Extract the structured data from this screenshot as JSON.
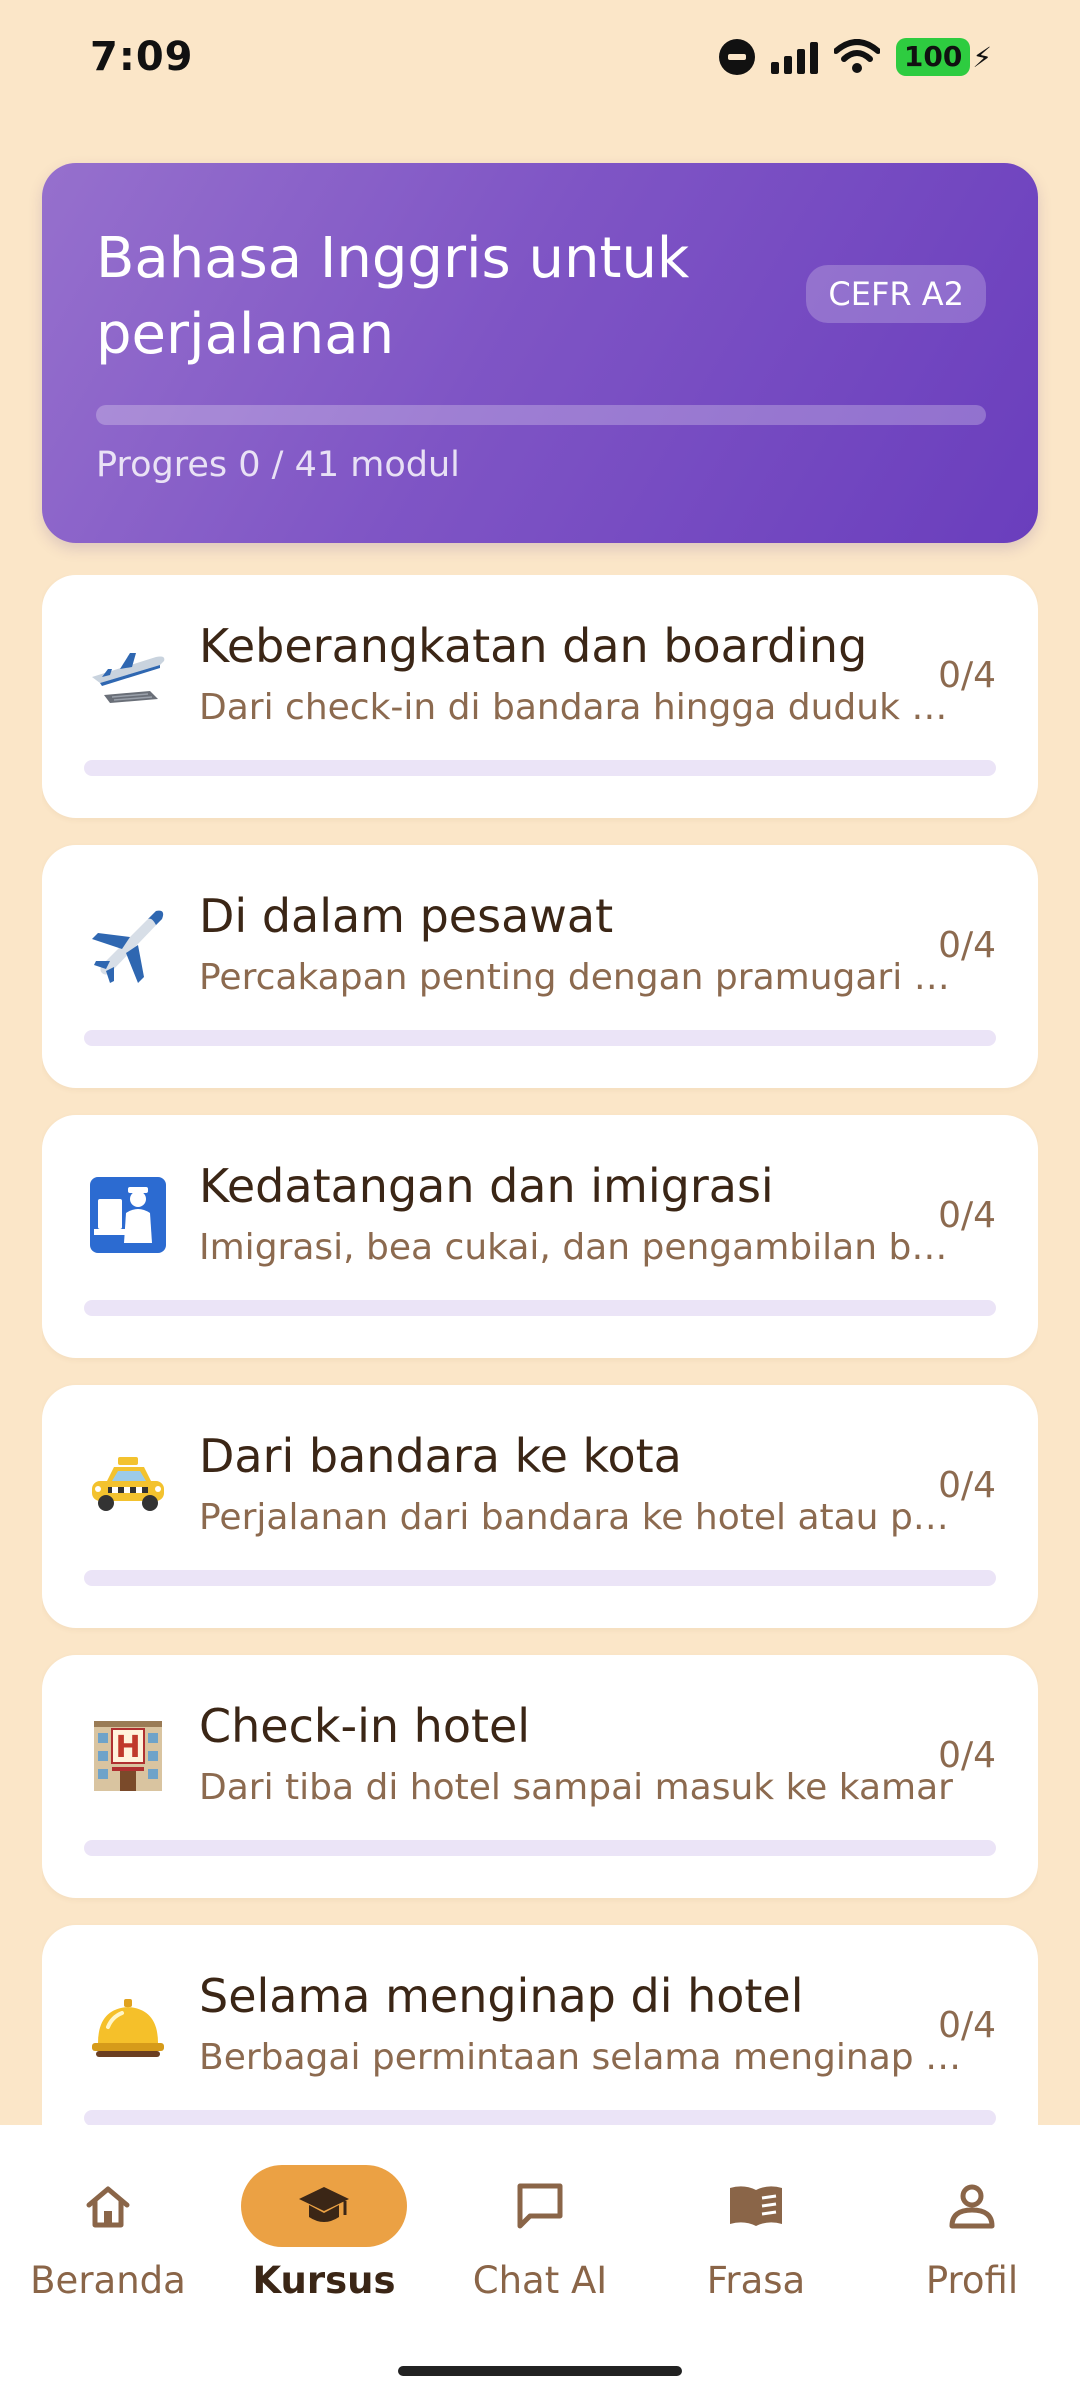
{
  "status_bar": {
    "time": "7:09",
    "battery": "100"
  },
  "course": {
    "title": "Bahasa Inggris untuk perjalanan",
    "level_badge": "CEFR A2",
    "progress_text": "Progres 0 / 41 modul",
    "progress_fraction": 0
  },
  "modules": [
    {
      "icon": "departure-plane-icon",
      "title": "Keberangkatan dan boarding",
      "description": "Dari check-in di bandara hingga duduk di kursi pesawat",
      "count": "0/4",
      "progress": 0
    },
    {
      "icon": "airplane-icon",
      "title": "Di dalam pesawat",
      "description": "Percakapan penting dengan pramugari atau penumpang lain",
      "count": "0/4",
      "progress": 0
    },
    {
      "icon": "passport-control-icon",
      "title": "Kedatangan dan imigrasi",
      "description": "Imigrasi, bea cukai, dan pengambilan bagasi",
      "count": "0/4",
      "progress": 0
    },
    {
      "icon": "taxi-icon",
      "title": "Dari bandara ke kota",
      "description": "Perjalanan dari bandara ke hotel atau pusat kota",
      "count": "0/4",
      "progress": 0
    },
    {
      "icon": "hotel-icon",
      "title": "Check-in hotel",
      "description": "Dari tiba di hotel sampai masuk ke kamar",
      "count": "0/4",
      "progress": 0
    },
    {
      "icon": "bellhop-bell-icon",
      "title": "Selama menginap di hotel",
      "description": "Berbagai permintaan selama menginap dan layanan hotel",
      "count": "0/4",
      "progress": 0
    }
  ],
  "nav": [
    {
      "label": "Beranda",
      "icon": "home-icon",
      "active": false
    },
    {
      "label": "Kursus",
      "icon": "graduation-cap-icon",
      "active": true
    },
    {
      "label": "Chat AI",
      "icon": "chat-bubble-icon",
      "active": false
    },
    {
      "label": "Frasa",
      "icon": "book-icon",
      "active": false
    },
    {
      "label": "Profil",
      "icon": "person-icon",
      "active": false
    }
  ],
  "colors": {
    "accent": "#7f55c5",
    "nav_active": "#eba144",
    "background": "#fbe6c8"
  }
}
